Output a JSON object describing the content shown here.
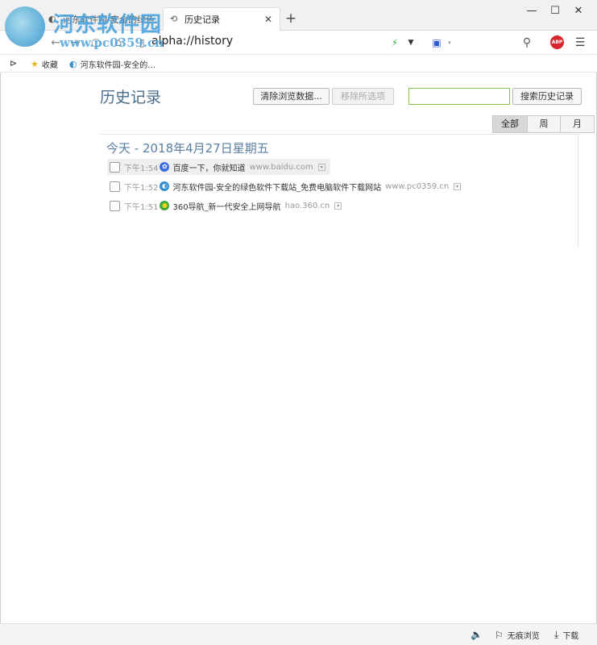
{
  "browser": {
    "tabs": [
      {
        "title": "河东软件园-安全的绿色软件…",
        "active": false
      },
      {
        "title": "历史记录",
        "active": true
      }
    ],
    "new_tab": "+",
    "window_controls": {
      "minimize": "—",
      "maximize": "☐",
      "close": "✕"
    },
    "address": "alpha://history",
    "bookmarks": [
      {
        "label": "收藏",
        "icon": "star-icon"
      },
      {
        "label": "河东软件园-安全的…",
        "icon": "site-icon"
      }
    ]
  },
  "watermark": {
    "name": "河东软件园",
    "url": "www.pc0359.cn"
  },
  "history": {
    "title": "历史记录",
    "clear_button": "清除浏览数据...",
    "remove_button": "移除所选项",
    "search_value": "",
    "search_button": "搜索历史记录",
    "filters": [
      "全部",
      "周",
      "月"
    ],
    "active_filter": "全部",
    "day_heading": "今天 - 2018年4月27日星期五",
    "entries": [
      {
        "time": "下午1:54",
        "title": "百度一下，你就知道",
        "domain": "www.baidu.com",
        "favicon": "baidu-paw-icon",
        "color": "#3b6fe0"
      },
      {
        "time": "下午1:52",
        "title": "河东软件园-安全的绿色软件下载站_免费电脑软件下载网站",
        "domain": "www.pc0359.cn",
        "favicon": "pc0359-icon",
        "color": "#2f8fd0"
      },
      {
        "time": "下午1:51",
        "title": "360导航_新一代安全上网导航",
        "domain": "hao.360.cn",
        "favicon": "360-icon",
        "color": "#3aa83a"
      }
    ]
  },
  "statusbar": {
    "sound": "",
    "incognito": "无痕浏览",
    "download": "下载"
  },
  "colors": {
    "accent": "#4a6b8a",
    "search_border": "#7dc34d",
    "abp": "#d8262c"
  }
}
